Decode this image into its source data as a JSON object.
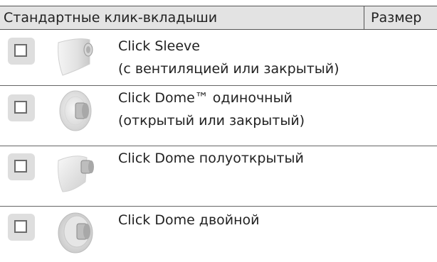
{
  "table": {
    "header_title": "Стандартные клик-вкладыши",
    "header_size": "Размер",
    "rows": [
      {
        "line1": "Click Sleeve",
        "line2": "(с вентиляцией или закрытый)",
        "icon": "click-sleeve-icon"
      },
      {
        "line1": "Click Dome™ одиночный",
        "line2": "(открытый или закрытый)",
        "icon": "click-dome-single-icon"
      },
      {
        "line1": "Click Dome полуоткрытый",
        "line2": "",
        "icon": "click-dome-semi-open-icon"
      },
      {
        "line1": "Click Dome двойной",
        "line2": "",
        "icon": "click-dome-double-icon"
      }
    ]
  },
  "colors": {
    "header_bg": "#e3e3e3",
    "divider": "#555555",
    "checkbox_bg": "#dedede",
    "checkbox_border": "#6b6b6b"
  }
}
